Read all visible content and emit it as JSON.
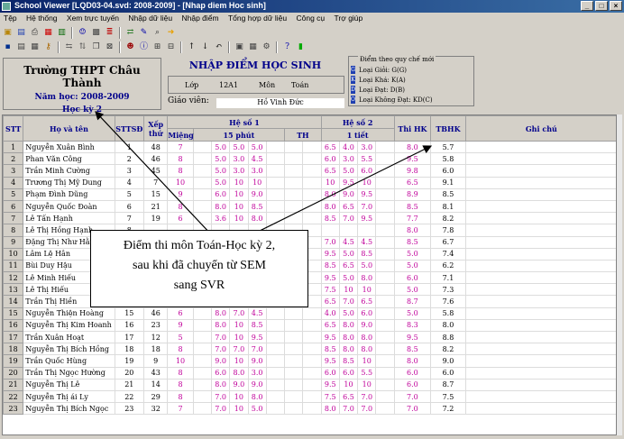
{
  "window": {
    "title": "School Viewer [LQD03-04.svd: 2008-2009] - [Nhap diem Hoc sinh]",
    "controls": [
      "_",
      "□",
      "×"
    ]
  },
  "menu": [
    "Tệp",
    "Hệ thống",
    "Xem trực tuyến",
    "Nhập dữ liệu",
    "Nhập điểm",
    "Tổng hợp dữ liệu",
    "Công cụ",
    "Trợ giúp"
  ],
  "school": {
    "name": "Trường THPT Châu Thành",
    "year": "Năm học: 2008-2009",
    "semester": "Học kỳ 2"
  },
  "entry": {
    "title": "NHẬP ĐIỂM HỌC SINH",
    "class_label": "Lớp",
    "class_value": "12A1",
    "subject_label": "Môn",
    "subject_value": "Toán",
    "teacher_label": "Giáo viên:",
    "teacher_value": "Hồ Vinh Đức"
  },
  "legend": {
    "title": "Điểm theo quy chế mới",
    "items": [
      {
        "code": "G",
        "label": "Loại Giỏi: G(G)"
      },
      {
        "code": "K",
        "label": "Loại Khá: K(A)"
      },
      {
        "code": "D",
        "label": "Loại Đạt: D(B)"
      },
      {
        "code": "O",
        "label": "Loại Không Đạt: KD(C)"
      }
    ]
  },
  "table": {
    "headers": {
      "stt": "STT",
      "name": "Họ và tên",
      "sttsd": "STTSĐ",
      "rank": "Xếp thứ",
      "hs1": "Hệ số 1",
      "mieng": "Miệng",
      "p15": "15 phút",
      "th": "TH",
      "hs2": "Hệ số 2",
      "t1": "1 tiết",
      "thk": "Thi HK",
      "tbhk": "TBHK",
      "note": "Ghi chú"
    },
    "rows": [
      {
        "stt": "1",
        "name": "Nguyễn Xuân Bình",
        "sttsd": "1",
        "rank": "48",
        "m": "7",
        "p": [
          "5.0",
          "5.0",
          "5.0"
        ],
        "t": [
          "6.5",
          "4.0",
          "3.0"
        ],
        "thk": "8.0",
        "tb": "5.7"
      },
      {
        "stt": "2",
        "name": "Phan Văn Công",
        "sttsd": "2",
        "rank": "46",
        "m": "8",
        "p": [
          "5.0",
          "3.0",
          "4.5"
        ],
        "t": [
          "6.0",
          "3.0",
          "5.5"
        ],
        "thk": "9.5",
        "tb": "5.8"
      },
      {
        "stt": "3",
        "name": "Trần Minh Cường",
        "sttsd": "3",
        "rank": "45",
        "m": "8",
        "p": [
          "5.0",
          "3.0",
          "3.0"
        ],
        "t": [
          "6.5",
          "5.0",
          "6.0"
        ],
        "thk": "9.8",
        "tb": "6.0"
      },
      {
        "stt": "4",
        "name": "Trương Thị Mỹ Dung",
        "sttsd": "4",
        "rank": "7",
        "m": "10",
        "p": [
          "5.0",
          "10",
          "10"
        ],
        "t": [
          "10",
          "9.5",
          "10"
        ],
        "thk": "6.5",
        "tb": "9.1"
      },
      {
        "stt": "5",
        "name": "Phạm Đình Dũng",
        "sttsd": "5",
        "rank": "15",
        "m": "9",
        "p": [
          "6.0",
          "10",
          "9.0"
        ],
        "t": [
          "8.0",
          "9.0",
          "9.5"
        ],
        "thk": "8.9",
        "tb": "8.5"
      },
      {
        "stt": "6",
        "name": "Nguyễn Quốc Đoàn",
        "sttsd": "6",
        "rank": "21",
        "m": "8",
        "p": [
          "8.0",
          "10",
          "8.5"
        ],
        "t": [
          "8.0",
          "6.5",
          "7.0"
        ],
        "thk": "8.5",
        "tb": "8.1"
      },
      {
        "stt": "7",
        "name": "Lê Tấn Hạnh",
        "sttsd": "7",
        "rank": "19",
        "m": "6",
        "p": [
          "3.6",
          "10",
          "8.0"
        ],
        "t": [
          "8.5",
          "7.0",
          "9.5"
        ],
        "thk": "7.7",
        "tb": "8.2"
      },
      {
        "stt": "8",
        "name": "Lê Thị Hồng Hạnh",
        "sttsd": "8",
        "rank": "",
        "m": "",
        "p": [
          "",
          "",
          ""
        ],
        "t": [
          "",
          "",
          ""
        ],
        "thk": "8.0",
        "tb": "7.8"
      },
      {
        "stt": "9",
        "name": "Đặng Thị Như Hằng",
        "sttsd": "9",
        "rank": "",
        "m": "",
        "p": [
          "",
          "",
          ""
        ],
        "t": [
          "7.0",
          "4.5",
          "4.5"
        ],
        "thk": "8.5",
        "tb": "6.7"
      },
      {
        "stt": "10",
        "name": "Lâm Lệ Hân",
        "sttsd": "10",
        "rank": "",
        "m": "",
        "p": [
          "",
          "",
          ""
        ],
        "t": [
          "9.5",
          "5.0",
          "8.5"
        ],
        "thk": "5.0",
        "tb": "7.4"
      },
      {
        "stt": "11",
        "name": "Bùi Duy Hậu",
        "sttsd": "11",
        "rank": "",
        "m": "",
        "p": [
          "",
          "",
          ""
        ],
        "t": [
          "8.5",
          "6.5",
          "5.0"
        ],
        "thk": "5.0",
        "tb": "6.2"
      },
      {
        "stt": "12",
        "name": "Lê Minh Hiếu",
        "sttsd": "12",
        "rank": "",
        "m": "",
        "p": [
          "",
          "",
          ""
        ],
        "t": [
          "9.5",
          "5.0",
          "8.0"
        ],
        "thk": "6.0",
        "tb": "7.1"
      },
      {
        "stt": "13",
        "name": "Lê Thị Hiếu",
        "sttsd": "13",
        "rank": "",
        "m": "",
        "p": [
          "",
          "",
          ""
        ],
        "t": [
          "7.5",
          "10",
          "10"
        ],
        "thk": "5.0",
        "tb": "7.3"
      },
      {
        "stt": "14",
        "name": "Trần Thị Hiền",
        "sttsd": "14",
        "rank": "28",
        "m": "8",
        "p": [
          "6.5",
          "8.0",
          "8.0"
        ],
        "t": [
          "6.5",
          "7.0",
          "6.5"
        ],
        "thk": "8.7",
        "tb": "7.6"
      },
      {
        "stt": "15",
        "name": "Nguyễn Thiện Hoàng",
        "sttsd": "15",
        "rank": "46",
        "m": "6",
        "p": [
          "8.0",
          "7.0",
          "4.5"
        ],
        "t": [
          "4.0",
          "5.0",
          "6.0"
        ],
        "thk": "5.0",
        "tb": "5.8"
      },
      {
        "stt": "16",
        "name": "Nguyễn Thị Kim Hoanh",
        "sttsd": "16",
        "rank": "23",
        "m": "9",
        "p": [
          "8.0",
          "10",
          "8.5"
        ],
        "t": [
          "6.5",
          "8.0",
          "9.0"
        ],
        "thk": "8.3",
        "tb": "8.0"
      },
      {
        "stt": "17",
        "name": "Trần Xuân Hoạt",
        "sttsd": "17",
        "rank": "12",
        "m": "5",
        "p": [
          "7.0",
          "10",
          "9.5"
        ],
        "t": [
          "9.5",
          "8.0",
          "8.0"
        ],
        "thk": "9.5",
        "tb": "8.8"
      },
      {
        "stt": "18",
        "name": "Nguyễn Thị Bích Hồng",
        "sttsd": "18",
        "rank": "18",
        "m": "8",
        "p": [
          "7.0",
          "7.0",
          "7.0"
        ],
        "t": [
          "8.5",
          "8.0",
          "8.0"
        ],
        "thk": "8.5",
        "tb": "8.2"
      },
      {
        "stt": "19",
        "name": "Trần Quốc Hùng",
        "sttsd": "19",
        "rank": "9",
        "m": "10",
        "p": [
          "9.0",
          "10",
          "9.0"
        ],
        "t": [
          "9.5",
          "8.5",
          "10"
        ],
        "thk": "8.0",
        "tb": "9.0"
      },
      {
        "stt": "20",
        "name": "Trần Thị Ngọc Hường",
        "sttsd": "20",
        "rank": "43",
        "m": "8",
        "p": [
          "6.0",
          "8.0",
          "3.0"
        ],
        "t": [
          "6.0",
          "6.0",
          "5.5"
        ],
        "thk": "6.0",
        "tb": "6.0"
      },
      {
        "stt": "21",
        "name": "Nguyễn Thị Lê",
        "sttsd": "21",
        "rank": "14",
        "m": "8",
        "p": [
          "8.0",
          "9.0",
          "9.0"
        ],
        "t": [
          "9.5",
          "10",
          "10"
        ],
        "thk": "6.0",
        "tb": "8.7"
      },
      {
        "stt": "22",
        "name": "Nguyễn Thị ái Ly",
        "sttsd": "22",
        "rank": "29",
        "m": "8",
        "p": [
          "7.0",
          "10",
          "8.0"
        ],
        "t": [
          "7.5",
          "6.5",
          "7.0"
        ],
        "thk": "7.0",
        "tb": "7.5"
      },
      {
        "stt": "23",
        "name": "Nguyễn Thị Bích Ngọc",
        "sttsd": "23",
        "rank": "32",
        "m": "7",
        "p": [
          "7.0",
          "10",
          "5.0"
        ],
        "t": [
          "8.0",
          "7.0",
          "7.0"
        ],
        "thk": "7.0",
        "tb": "7.2"
      }
    ]
  },
  "callout": {
    "line1": "Điểm thi môn Toán-Học kỳ 2,",
    "line2": "sau khi đã chuyển từ SEM",
    "line3": "sang SVR"
  }
}
